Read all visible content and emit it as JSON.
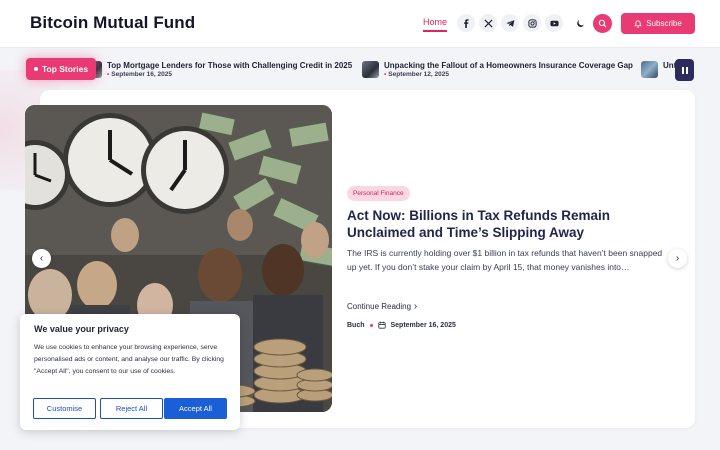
{
  "header": {
    "site_title": "Bitcoin Mutual Fund",
    "nav_home": "Home",
    "subscribe_label": "Subscribe",
    "social_icons": [
      "facebook-icon",
      "x-icon",
      "telegram-icon",
      "instagram-icon",
      "youtube-icon"
    ],
    "theme_toggle_icon": "moon-icon",
    "search_icon": "search-icon"
  },
  "ticker": {
    "label": "Top Stories",
    "items": [
      {
        "title": "Top Mortgage Lenders for Those with Challenging Credit in 2025",
        "date": "September 16, 2025"
      },
      {
        "title": "Unpacking the Fallout of a Homeowners Insurance Coverage Gap",
        "date": "September 12, 2025"
      },
      {
        "title": "Unt",
        "date": ""
      }
    ]
  },
  "featured": {
    "category": "Personal Finance",
    "headline": "Act Now: Billions in Tax Refunds Remain Unclaimed and Time’s Slipping Away",
    "excerpt": "The IRS is currently holding over $1 billion in tax refunds that haven’t been snapped up yet. If you don’t stake your claim by April 15, that money vanishes into…",
    "continue_label": "Continue Reading",
    "author": "Buch",
    "date": "September 16, 2025"
  },
  "cookie": {
    "title": "We value your privacy",
    "text": "We use cookies to enhance your browsing experience, serve personalised ads or content, and analyse our traffic. By clicking \"Accept All\", you consent to our use of cookies.",
    "customise": "Customise",
    "reject": "Reject All",
    "accept": "Accept All"
  },
  "colors": {
    "accent": "#e93a73",
    "navy": "#2d2a5e",
    "cookie_blue": "#1a5fd6"
  }
}
